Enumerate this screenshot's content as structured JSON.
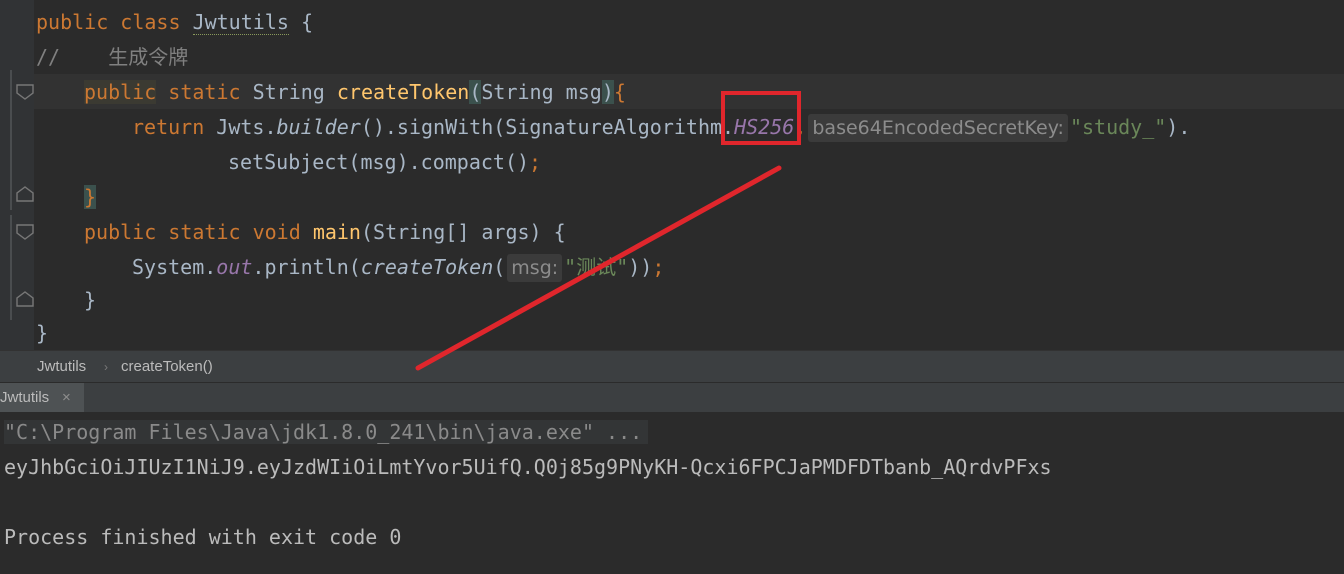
{
  "editor": {
    "line1": {
      "kw1": "public",
      "kw2": "class",
      "classname": "Jwtutils",
      "brace": "{"
    },
    "line2": {
      "comment": "//    生成令牌"
    },
    "line3": {
      "kw1": "public",
      "kw2": "static",
      "type": "String",
      "method": "createToken",
      "paren_open": "(",
      "params": "String msg",
      "paren_close": ")",
      "brace": "{"
    },
    "line4": {
      "kw": "return",
      "obj": "Jwts.",
      "builder": "builder",
      "call1": "().signWith(SignatureAlgorithm.",
      "hs": "HS256",
      "comma": ",",
      "hint": "base64EncodedSecretKey:",
      "str": "\"study_\"",
      "end": ")."
    },
    "line5": {
      "text": "setSubject(msg).compact()",
      "semi": ";"
    },
    "line6": {
      "brace": "}"
    },
    "line7": {
      "kw1": "public",
      "kw2": "static",
      "kw3": "void",
      "method": "main",
      "params": "(String[] args)",
      "brace": "{"
    },
    "line8": {
      "sys": "System.",
      "out": "out",
      "println": ".println(",
      "call": "createToken",
      "paren": "(",
      "hint": "msg:",
      "str": "\"测试\"",
      "end": "))",
      "semi": ";"
    },
    "line9": {
      "brace": "}"
    },
    "line10": {
      "brace": "}"
    }
  },
  "breadcrumb": {
    "items": [
      "Jwtutils",
      "createToken()"
    ],
    "separator": "›"
  },
  "run_panel": {
    "tab_label": "Jwtutils",
    "tab_close": "×",
    "console": {
      "command": "\"C:\\Program Files\\Java\\jdk1.8.0_241\\bin\\java.exe\" ...",
      "token": "eyJhbGciOiJIUzI1NiJ9.eyJzdWIiOiLmtYvor5UifQ.Q0j85g9PNyKH-Qcxi6FPCJaPMDFDTbanb_AQrdvPFxs",
      "exit": "Process finished with exit code 0"
    }
  },
  "colors": {
    "background": "#2b2b2b",
    "keyword": "#cc7832",
    "method": "#ffc66d",
    "string": "#6a8759",
    "comment": "#808080",
    "static_field": "#9876aa",
    "annotation": "#e0262c"
  }
}
